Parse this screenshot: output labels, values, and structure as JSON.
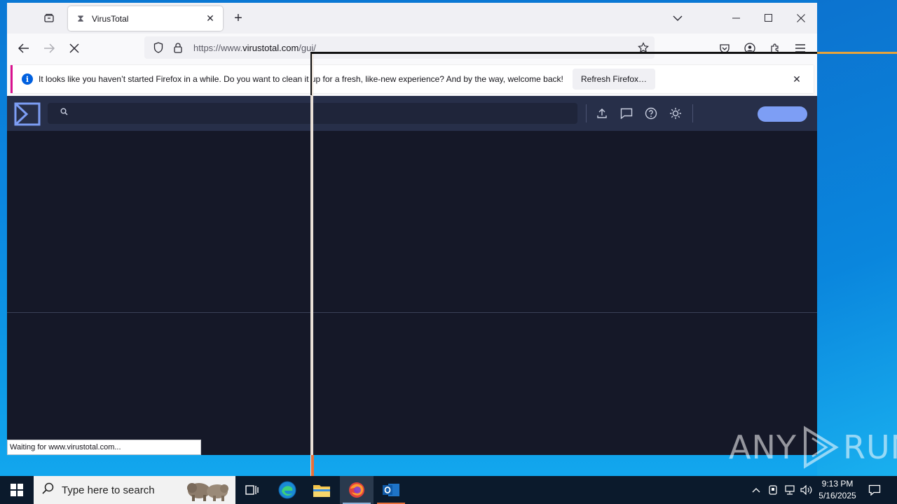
{
  "browser": {
    "tab": {
      "title": "VirusTotal"
    },
    "url": {
      "prefix": "https://www.",
      "domain": "virustotal.com",
      "path": "/gui/"
    },
    "notification": {
      "message": "It looks like you haven’t started Firefox in a while. Do you want to clean it up for a fresh, like-new experience? And by the way, welcome back!",
      "button_label": "Refresh Firefox…"
    },
    "status_text": "Waiting for www.virustotal.com..."
  },
  "page": {
    "brand_color": "#7d9ef5",
    "header_bg": "#272f49",
    "body_bg": "#151828"
  },
  "watermark": {
    "left": "ANY",
    "right": "RUN"
  },
  "taskbar": {
    "search_placeholder": "Type here to search",
    "time": "9:13 PM",
    "date": "5/16/2025"
  }
}
